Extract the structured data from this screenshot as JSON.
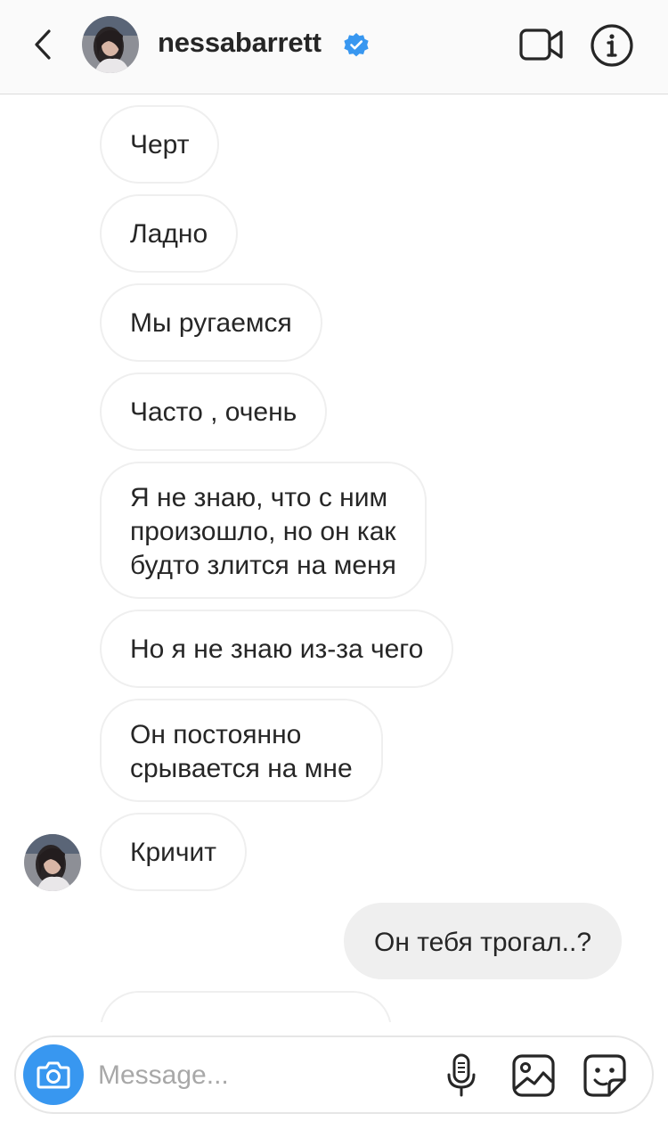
{
  "header": {
    "username": "nessabarrett",
    "verified": true,
    "icons": [
      "back-chevron-icon",
      "verified-badge-icon",
      "video-call-icon",
      "info-icon"
    ]
  },
  "messages": [
    {
      "direction": "received",
      "text": "Черт"
    },
    {
      "direction": "received",
      "text": "Ладно"
    },
    {
      "direction": "received",
      "text": "Мы ругаемся"
    },
    {
      "direction": "received",
      "text": "Часто , очень"
    },
    {
      "direction": "received",
      "text": "Я не знаю, что с ним\nпроизошло, но он как\nбудто злится на меня"
    },
    {
      "direction": "received",
      "text": "Но я не знаю из-за чего"
    },
    {
      "direction": "received",
      "text": "Он постоянно\nсрывается на мне"
    },
    {
      "direction": "received",
      "text": "Кричит"
    },
    {
      "direction": "sent",
      "text": "Он тебя трогал..?"
    },
    {
      "direction": "received",
      "text": ""
    }
  ],
  "composer": {
    "placeholder": "Message...",
    "icons": [
      "camera-icon",
      "microphone-icon",
      "gallery-icon",
      "sticker-icon"
    ]
  },
  "colors": {
    "accent": "#3897f0",
    "verified": "#3897f0",
    "bubble_border": "#efefef",
    "sent_bubble": "#efefef",
    "text": "#262626",
    "placeholder": "#a8a8a8"
  }
}
